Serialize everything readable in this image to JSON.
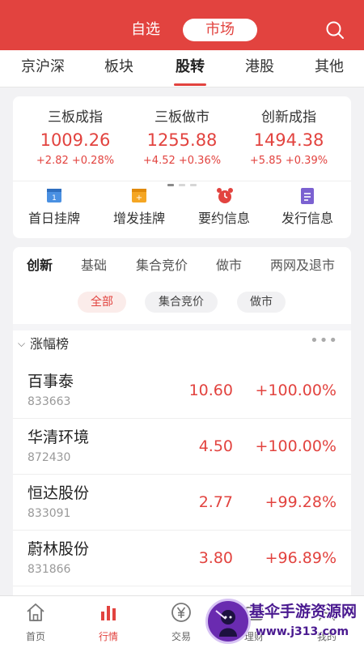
{
  "header": {
    "tabs": [
      "自选",
      "市场"
    ],
    "active_tab": "市场",
    "accent": "#e2433f"
  },
  "topnav": {
    "tabs": [
      "京沪深",
      "板块",
      "股转",
      "港股",
      "其他"
    ],
    "active": "股转"
  },
  "indices": [
    {
      "name": "三板成指",
      "value": "1009.26",
      "change": "+2.82 +0.28%"
    },
    {
      "name": "三板做市",
      "value": "1255.88",
      "change": "+4.52 +0.36%"
    },
    {
      "name": "创新成指",
      "value": "1494.38",
      "change": "+5.85 +0.39%"
    }
  ],
  "quick_actions": [
    {
      "label": "首日挂牌",
      "icon": "calendar-icon",
      "color": "#4a90e2"
    },
    {
      "label": "增发挂牌",
      "icon": "add-calendar-icon",
      "color": "#f5a623"
    },
    {
      "label": "要约信息",
      "icon": "alarm-clock-icon",
      "color": "#e2433f"
    },
    {
      "label": "发行信息",
      "icon": "document-icon",
      "color": "#7b61d1"
    }
  ],
  "subtabs": [
    "创新",
    "基础",
    "集合竞价",
    "做市",
    "两网及退市"
  ],
  "subtab_active": "创新",
  "filters": [
    "全部",
    "集合竞价",
    "做市"
  ],
  "filter_active": "全部",
  "section": {
    "title": "涨幅榜",
    "more": "•••"
  },
  "stocks": [
    {
      "name": "百事泰",
      "code": "833663",
      "price": "10.60",
      "change": "+100.00%"
    },
    {
      "name": "华清环境",
      "code": "872430",
      "price": "4.50",
      "change": "+100.00%"
    },
    {
      "name": "恒达股份",
      "code": "833091",
      "price": "2.77",
      "change": "+99.28%"
    },
    {
      "name": "蔚林股份",
      "code": "831866",
      "price": "3.80",
      "change": "+96.89%"
    }
  ],
  "bottom_nav": [
    {
      "label": "首页",
      "icon": "home-icon"
    },
    {
      "label": "行情",
      "icon": "bar-chart-icon"
    },
    {
      "label": "交易",
      "icon": "yen-icon"
    },
    {
      "label": "理财",
      "icon": "wallet-icon"
    },
    {
      "label": "我的",
      "icon": "user-icon"
    }
  ],
  "bottom_active": "行情",
  "watermark": {
    "line1": "基伞手游资源网",
    "line2": "www.j313.com"
  }
}
